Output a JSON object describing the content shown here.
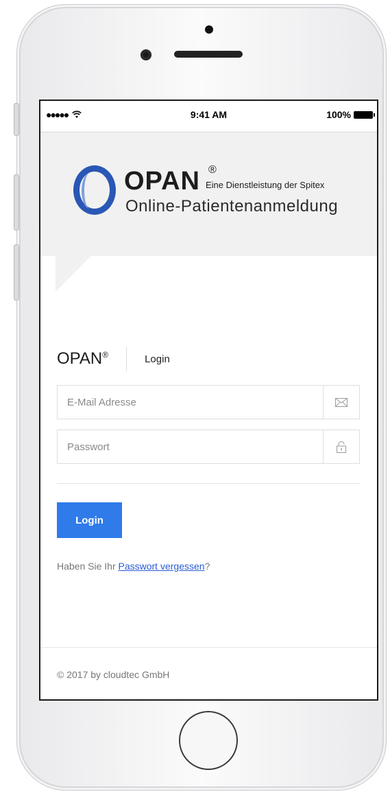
{
  "status_bar": {
    "signal": "●●●●● ",
    "wifi": "wifi-icon",
    "time": "9:41 AM",
    "battery": "100%"
  },
  "logo": {
    "name": "OPAN",
    "reg": "®",
    "tagline": "Eine Dienstleistung der Spitex",
    "subtitle": "Online-Patientenanmeldung"
  },
  "form": {
    "brand": "OPAN",
    "brand_reg": "®",
    "heading": "Login",
    "email_placeholder": "E-Mail Adresse",
    "email_icon": "envelope-icon",
    "password_placeholder": "Passwort",
    "password_icon": "lock-icon",
    "submit_label": "Login",
    "forgot_prefix": "Haben Sie Ihr ",
    "forgot_link": "Passwort vergessen",
    "forgot_suffix": "?"
  },
  "footer": {
    "copyright": "© 2017 by cloudtec GmbH"
  },
  "colors": {
    "accent": "#2f7bea",
    "logo_blue": "#2a57b5",
    "banner_bg": "#f1f1f1"
  }
}
